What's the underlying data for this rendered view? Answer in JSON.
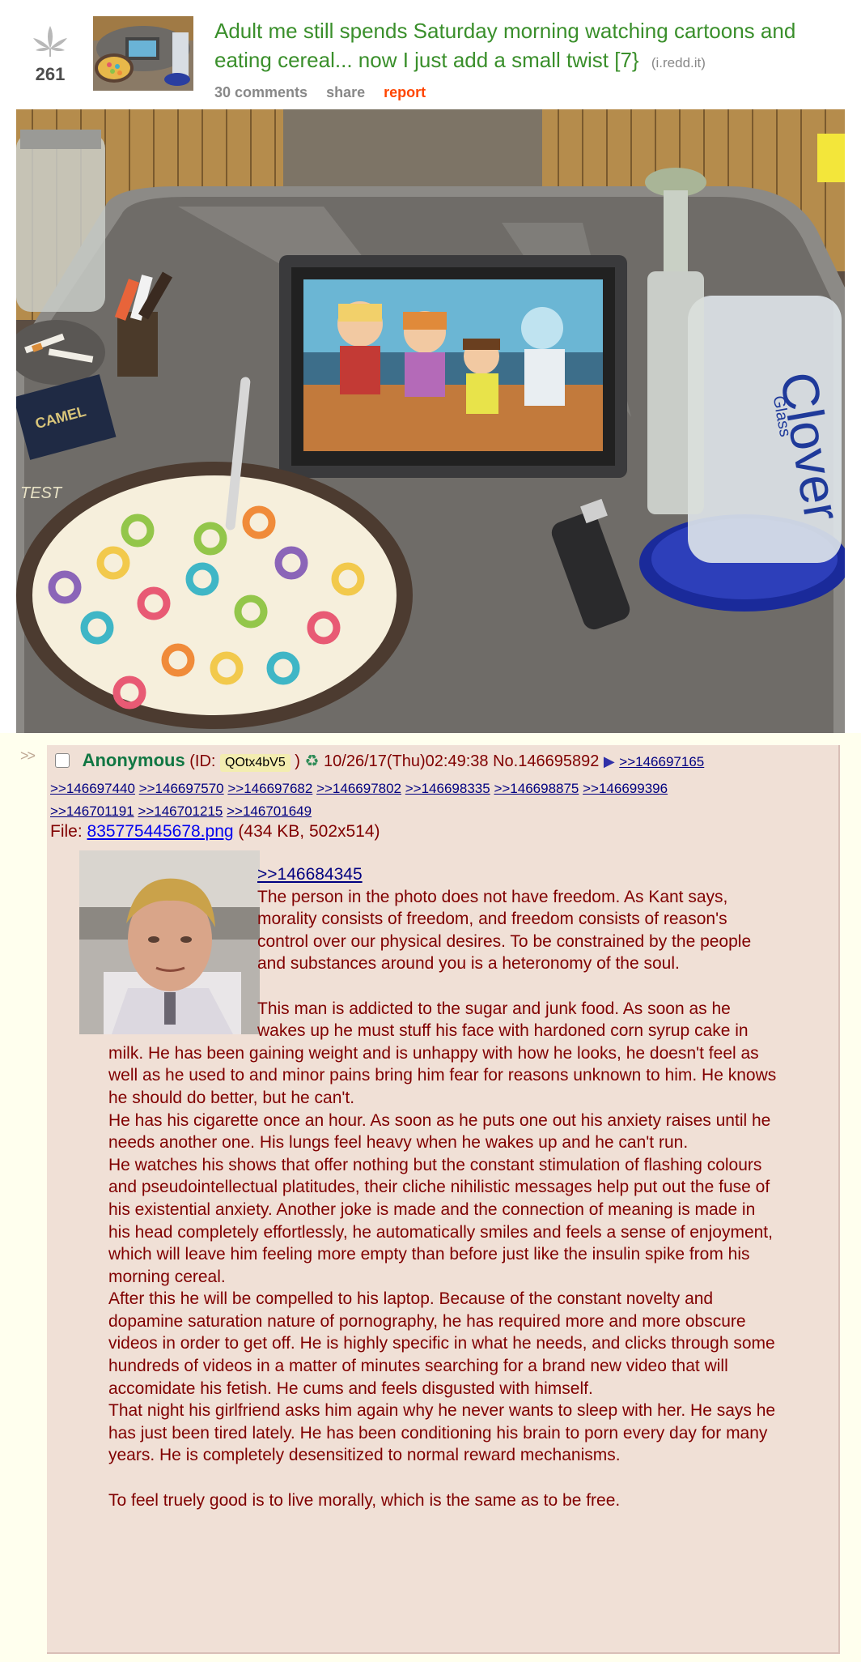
{
  "reddit": {
    "score": "261",
    "title": "Adult me still spends Saturday morning watching cartoons and eating cereal... now I just add a small twist [7}",
    "domain": "(i.redd.it)",
    "actions": {
      "comments": "30 comments",
      "share": "share",
      "report": "report"
    },
    "icons": {
      "vote": "leaf-icon"
    },
    "colors": {
      "title": "#3a8f2b",
      "report": "#ff4500"
    }
  },
  "photo": {
    "cereal_box_text": "CAMEL",
    "bong_brand": "Clover",
    "bong_sub": "Glass",
    "book_text": "TEST"
  },
  "post": {
    "arrows": ">>",
    "name": "Anonymous",
    "id_prefix": "(ID:",
    "id": "QOtx4bV5",
    "id_suffix": ")",
    "recycle": "♻",
    "datetime": "10/26/17(Thu)02:49:38",
    "number": "No.146695892",
    "backlinks": [
      ">>146697165",
      ">>146697440",
      ">>146697570",
      ">>146697682",
      ">>146697802",
      ">>146698335",
      ">>146698875",
      ">>146699396",
      ">>146701191",
      ">>146701215",
      ">>146701649"
    ],
    "file_label": "File:",
    "file_name": "835775445678.png",
    "file_info": "(434 KB, 502x514)",
    "quote": ">>146684345",
    "paragraphs": [
      "The person in the photo does not have freedom. As Kant says, morality consists of freedom, and freedom consists of reason's control over our physical desires. To be constrained by the people and substances around you is a heteronomy of the soul.",
      "",
      "This man is addicted to the sugar and junk food. As soon as he wakes up he must stuff his face with hardoned corn syrup cake in milk. He has been gaining weight and is unhappy with how he looks, he doesn't feel as well as he used to and minor pains bring him fear for reasons unknown to him. He knows he should do better, but he can't.",
      "He has his cigarette once an hour. As soon as he puts one out his anxiety raises until he needs another one. His lungs feel heavy when he wakes up and he can't run.",
      "He watches his shows that offer nothing but the constant stimulation of flashing colours and pseudointellectual platitudes, their cliche nihilistic messages help put out the fuse of his existential anxiety. Another joke is made and the connection of meaning is made in his head completely effortlessly, he automatically smiles and feels a sense of enjoyment, which will leave him feeling more empty than before just like the insulin spike from his morning cereal.",
      "After this he will be compelled to his laptop. Because of the constant novelty and dopamine saturation nature of pornography, he has required more and more obscure videos in order to get off. He is highly specific in what he needs, and clicks through some hundreds of videos in a matter of minutes searching for a brand new video that will accomidate his fetish. He cums and feels disgusted with himself.",
      "That night his girlfriend asks him again why he never wants to sleep with her. He says he has just been tired lately. He has been conditioning his brain to porn every day for many years. He is completely desensitized to normal reward mechanisms.",
      "",
      "To feel truely good is to live morally, which is the same as to be free."
    ],
    "colors": {
      "name": "#117743",
      "text": "#800000",
      "reply_bg": "#f0e0d6",
      "page_bg": "#ffffee"
    }
  }
}
